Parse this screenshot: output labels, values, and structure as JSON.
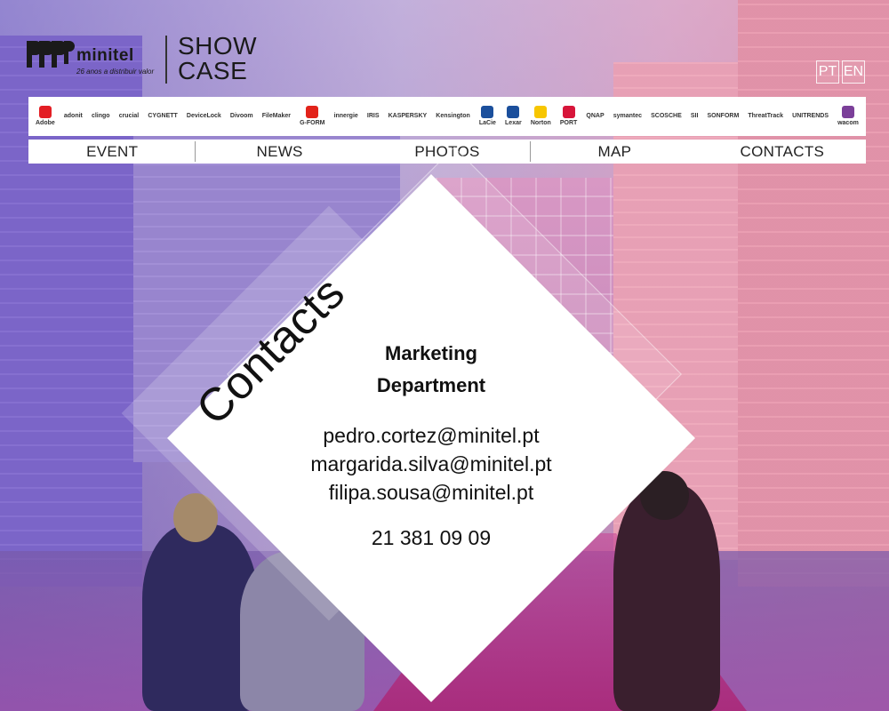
{
  "header": {
    "brand_name": "minitel",
    "brand_tagline": "26 anos a distribuir valor",
    "showcase_line1": "SHOW",
    "showcase_line2": "CASE"
  },
  "languages": [
    {
      "label": "PT"
    },
    {
      "label": "EN"
    }
  ],
  "brands": [
    "Adobe",
    "adonit",
    "clingo",
    "crucial",
    "CYGNETT",
    "DeviceLock",
    "Divoom",
    "FileMaker",
    "G-FORM",
    "innergie",
    "IRIS",
    "KASPERSKY",
    "Kensington",
    "LaCie",
    "Lexar",
    "Norton",
    "PORT",
    "QNAP",
    "symantec",
    "SCOSCHE",
    "SII",
    "SONFORM",
    "ThreatTrack",
    "UNITRENDS",
    "wacom"
  ],
  "brand_colors": {
    "Adobe": "#e31e24",
    "G-FORM": "#e2231a",
    "PORT": "#d7153a",
    "LaCie": "#1b4f9c",
    "Lexar": "#1b4f9c",
    "Norton": "#f7c600",
    "wacom": "#7b3f99"
  },
  "nav": [
    {
      "label": "EVENT"
    },
    {
      "label": "NEWS"
    },
    {
      "label": "PHOTOS"
    },
    {
      "label": "MAP"
    },
    {
      "label": "CONTACTS"
    }
  ],
  "contacts": {
    "title": "Contacts",
    "department_line1": "Marketing",
    "department_line2": "Department",
    "emails": [
      "pedro.cortez@minitel.pt",
      "margarida.silva@minitel.pt",
      "filipa.sousa@minitel.pt"
    ],
    "phone": "21 381 09 09"
  }
}
